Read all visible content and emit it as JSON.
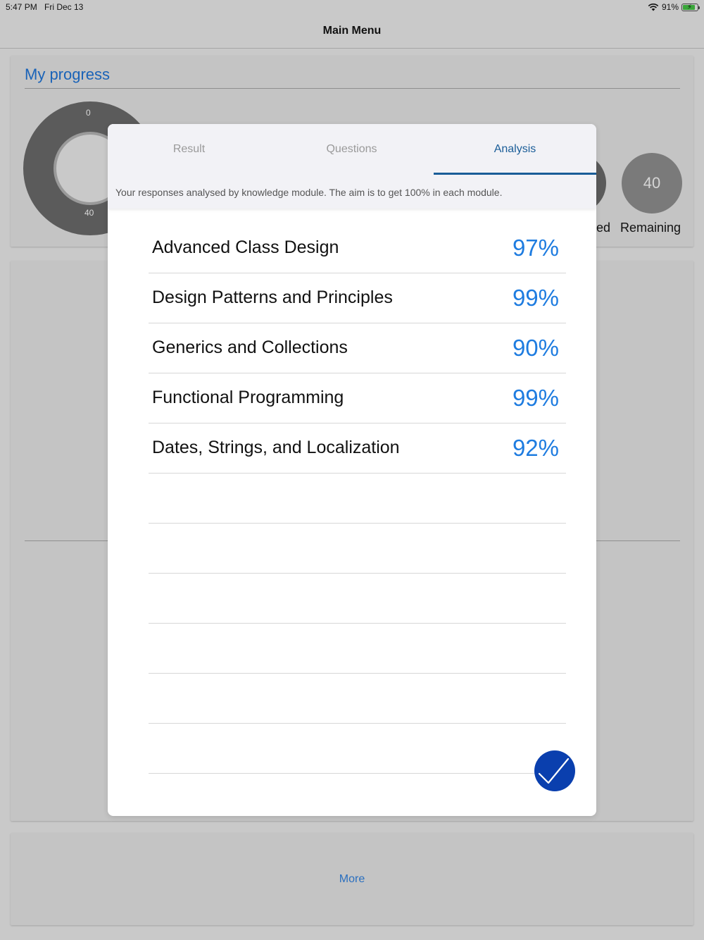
{
  "status_bar": {
    "time": "5:47 PM",
    "date": "Fri Dec 13",
    "battery": "91%",
    "battery_level": 0.91,
    "wifi_icon": "wifi-icon",
    "battery_icon": "battery-charging-icon"
  },
  "nav": {
    "title": "Main Menu"
  },
  "progress_card": {
    "title": "My progress",
    "donut_top_label": "0",
    "donut_bottom_label": "40",
    "partial_label": "ed",
    "remaining_value": "40",
    "remaining_label": "Remaining"
  },
  "more_card": {
    "label": "More"
  },
  "modal": {
    "tabs": [
      {
        "label": "Result",
        "active": false
      },
      {
        "label": "Questions",
        "active": false
      },
      {
        "label": "Analysis",
        "active": true
      }
    ],
    "subtitle": "Your responses analysed by knowledge module. The aim is to get 100% in each module.",
    "modules": [
      {
        "name": "Advanced Class Design",
        "percent": "97%"
      },
      {
        "name": "Design Patterns and Principles",
        "percent": "99%"
      },
      {
        "name": "Generics and Collections",
        "percent": "90%"
      },
      {
        "name": "Functional Programming",
        "percent": "99%"
      },
      {
        "name": "Dates, Strings, and Localization",
        "percent": "92%"
      }
    ],
    "empty_rows": 6,
    "done_icon": "checkmark-icon"
  },
  "colors": {
    "accent": "#1e7ce0",
    "tab_active": "#1a5d98",
    "done_button": "#0a3fae",
    "overlay_background": "#c9c9c9"
  }
}
